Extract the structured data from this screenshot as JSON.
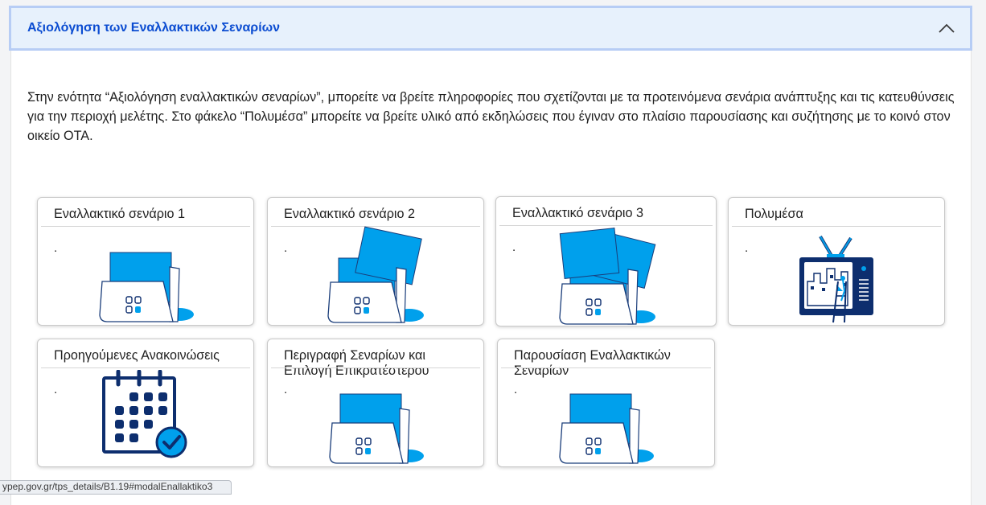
{
  "accordion": {
    "title": "Αξιολόγηση των Εναλλακτικών Σεναρίων",
    "expanded": true,
    "accent_color": "#0b4cd1"
  },
  "intro_text": "Στην ενότητα “Αξιολόγηση εναλλακτικών σεναρίων”, μπορείτε να βρείτε πληροφορίες που σχετίζονται με τα προτεινόμενα σενάρια ανάπτυξης και τις κατευθύνσεις για την περιοχή μελέτης. Στο φάκελο “Πολυμέσα” μπορείτε να βρείτε υλικό από εκδηλώσεις που έγιναν στο πλαίσιο παρουσίασης και συζήτησης με το κοινό στον οικείο ΟΤΑ.",
  "cards": [
    {
      "title": "Εναλλακτικό σενάριο 1",
      "text": ".",
      "icon": "folder-icon"
    },
    {
      "title": "Εναλλακτικό σενάριο 2",
      "text": ".",
      "icon": "folder-documents-icon"
    },
    {
      "title": "Εναλλακτικό σενάριο 3",
      "text": ".",
      "icon": "folder-documents-icon"
    },
    {
      "title": "Πολυμέσα",
      "text": ".",
      "icon": "television-icon"
    },
    {
      "title": "Προηγούμενες Ανακοινώσεις",
      "text": ".",
      "icon": "calendar-check-icon"
    },
    {
      "title": "Περιγραφή Σεναρίων και Επιλογή Επικρατέστερου",
      "text": ".",
      "icon": "folder-icon"
    },
    {
      "title": "Παρουσίαση Εναλλακτικών Σεναρίων",
      "text": ".",
      "icon": "folder-icon"
    }
  ],
  "icon_colors": {
    "blue": "#00a0ec",
    "navy": "#0d2e6e"
  },
  "status_bar_url": "ypep.gov.gr/tps_details/B1.19#modalEnallaktiko3"
}
